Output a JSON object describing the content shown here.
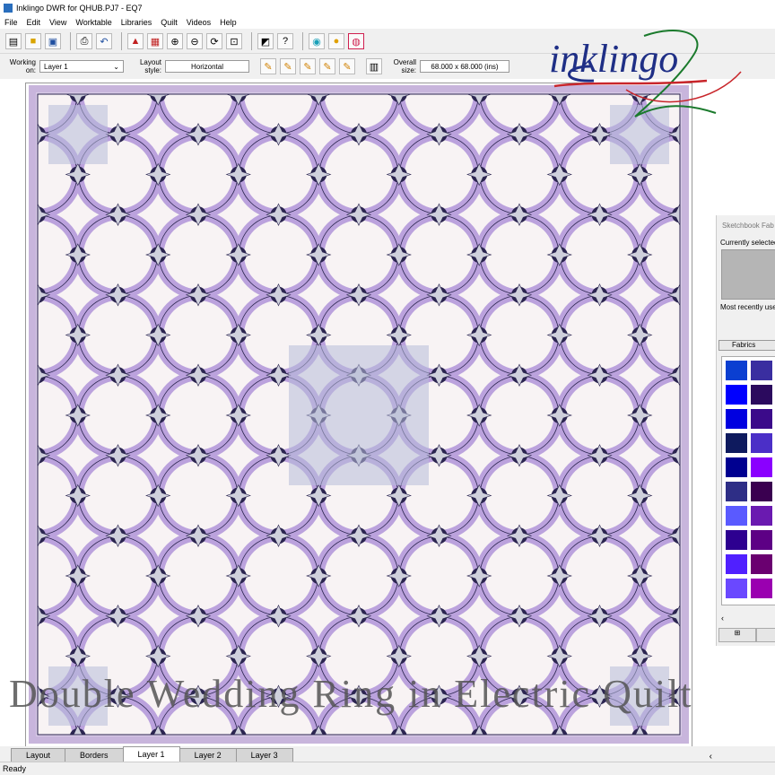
{
  "window": {
    "title": "Inklingo DWR for QHUB.PJ7 - EQ7"
  },
  "menu": [
    "File",
    "Edit",
    "View",
    "Worktable",
    "Libraries",
    "Quilt",
    "Videos",
    "Help"
  ],
  "toolbar": {
    "buttons": [
      "new-icon",
      "open-icon",
      "save-icon",
      "print-icon",
      "undo-icon",
      "add-to-sketchbook-icon",
      "view-sketchbook-icon",
      "zoom-in-icon",
      "zoom-out-icon",
      "refresh-icon",
      "fit-to-worktable-icon",
      "layout-tool-icon",
      "help-icon",
      "camera-icon",
      "color-tool-icon",
      "fabric-tool-icon"
    ]
  },
  "properties": {
    "working_on_label": "Working on:",
    "working_on_value": "Layer 1",
    "layout_style_label": "Layout style:",
    "layout_style_value": "Horizontal",
    "overall_size_label": "Overall size:",
    "overall_size_value": "68.000 x 68.000 (ins)"
  },
  "logo": {
    "text": "inklingo",
    "colors": {
      "primary": "#1f2f86",
      "swash": "#1a7a2c",
      "accent": "#c8262b"
    }
  },
  "side_panel": {
    "title": "Sketchbook Fab",
    "currently_selected": "Currently selected",
    "most_recently": "Most recently use",
    "fabrics_tab": "Fabrics",
    "palette": [
      "#0b3fd1",
      "#3a2ea0",
      "#0000ff",
      "#2b0a5e",
      "#0000e0",
      "#3b0a8a",
      "#0e1a5e",
      "#4b2fc7",
      "#000090",
      "#8a00ff",
      "#2e2e86",
      "#3a0050",
      "#5a5aff",
      "#6a1ab0",
      "#2d0090",
      "#5d0085",
      "#5020ff",
      "#6a0070",
      "#6a48ff",
      "#9a00b0"
    ]
  },
  "caption": "Double Wedding Ring in Electric Quilt",
  "tabs": [
    "Layout",
    "Borders",
    "Layer 1",
    "Layer 2",
    "Layer 3"
  ],
  "active_tab": "Layer 1",
  "status": "Ready",
  "quilt": {
    "colors": {
      "border": "#c8b5dc",
      "ring": "#bba2dd",
      "ring_dark": "#2b2550",
      "cell_light": "#f8f3f4",
      "cell_blue": "#b7bbd9",
      "melon": "#fbf7f8",
      "star": "#cfd0dc"
    }
  }
}
